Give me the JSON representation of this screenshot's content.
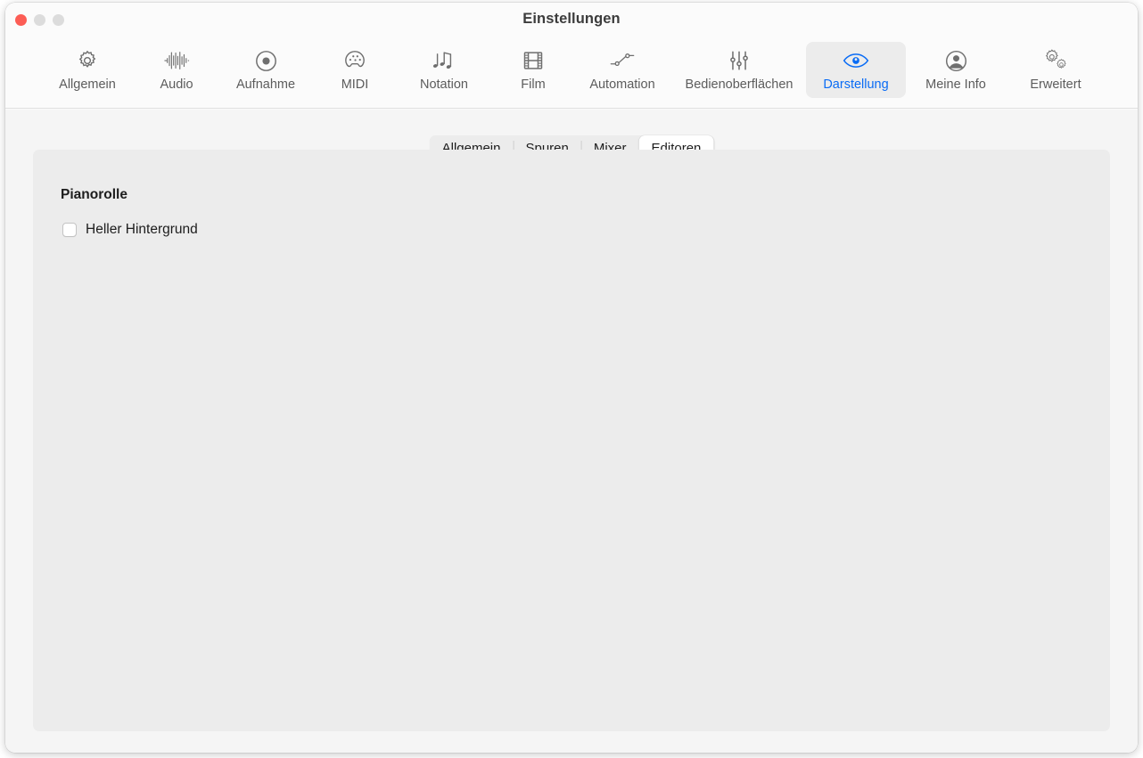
{
  "window": {
    "title": "Einstellungen",
    "traffic_lights": [
      {
        "name": "close",
        "color": "#fc5d55"
      },
      {
        "name": "minimize",
        "color": "#dcdcdc"
      },
      {
        "name": "maximize",
        "color": "#dcdcdc"
      }
    ]
  },
  "toolbar": {
    "items": [
      {
        "label": "Allgemein",
        "icon": "gear-icon",
        "selected": false
      },
      {
        "label": "Audio",
        "icon": "waveform-icon",
        "selected": false
      },
      {
        "label": "Aufnahme",
        "icon": "record-circle-icon",
        "selected": false
      },
      {
        "label": "MIDI",
        "icon": "midi-connector-icon",
        "selected": false
      },
      {
        "label": "Notation",
        "icon": "music-notes-icon",
        "selected": false
      },
      {
        "label": "Film",
        "icon": "film-strip-icon",
        "selected": false
      },
      {
        "label": "Automation",
        "icon": "automation-node-icon",
        "selected": false
      },
      {
        "label": "Bedienoberflächen",
        "icon": "sliders-icon",
        "selected": false
      },
      {
        "label": "Darstellung",
        "icon": "eye-icon",
        "selected": true
      },
      {
        "label": "Meine Info",
        "icon": "person-circle-icon",
        "selected": false
      },
      {
        "label": "Erweitert",
        "icon": "double-gear-icon",
        "selected": false
      }
    ],
    "selected_color": "#0a6cf5",
    "selected_background": "#ececec"
  },
  "segmented_control": {
    "tabs": [
      {
        "label": "Allgemein",
        "selected": false
      },
      {
        "label": "Spuren",
        "selected": false
      },
      {
        "label": "Mixer",
        "selected": false
      },
      {
        "label": "Editoren",
        "selected": true
      }
    ]
  },
  "panel": {
    "group_title": "Pianorolle",
    "checkbox": {
      "label": "Heller Hintergrund",
      "checked": false
    },
    "background": "#ececec"
  }
}
